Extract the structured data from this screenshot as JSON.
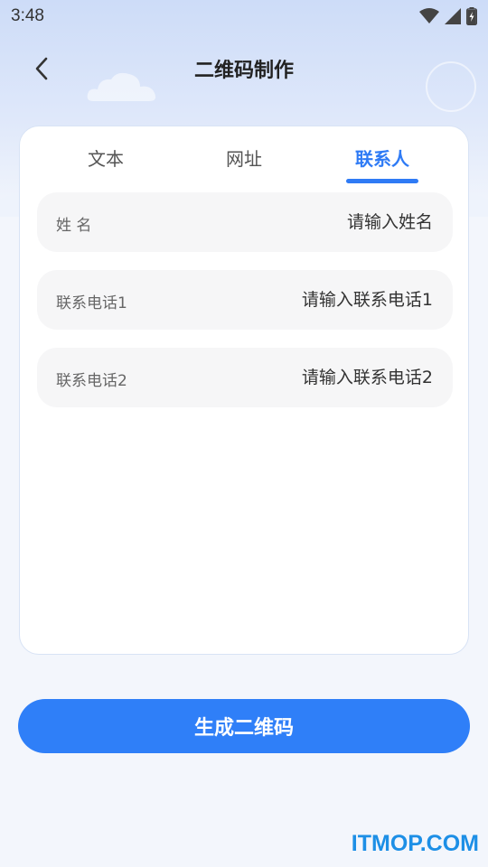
{
  "status_bar": {
    "time": "3:48"
  },
  "header": {
    "title": "二维码制作"
  },
  "tabs": [
    {
      "label": "文本",
      "active": false
    },
    {
      "label": "网址",
      "active": false
    },
    {
      "label": "联系人",
      "active": true
    }
  ],
  "form": {
    "fields": [
      {
        "label": "姓 名",
        "placeholder": "请输入姓名",
        "value": ""
      },
      {
        "label": "联系电话1",
        "placeholder": "请输入联系电话1",
        "value": ""
      },
      {
        "label": "联系电话2",
        "placeholder": "请输入联系电话2",
        "value": ""
      }
    ]
  },
  "actions": {
    "generate_label": "生成二维码"
  },
  "watermark": "ITMOP.COM",
  "colors": {
    "accent": "#2f7ff8",
    "tab_active": "#2f7bf5",
    "field_bg": "#f6f6f7"
  },
  "icons": {
    "back": "chevron-left-icon",
    "wifi": "wifi-icon",
    "signal": "cell-signal-icon",
    "battery": "battery-charging-icon"
  }
}
